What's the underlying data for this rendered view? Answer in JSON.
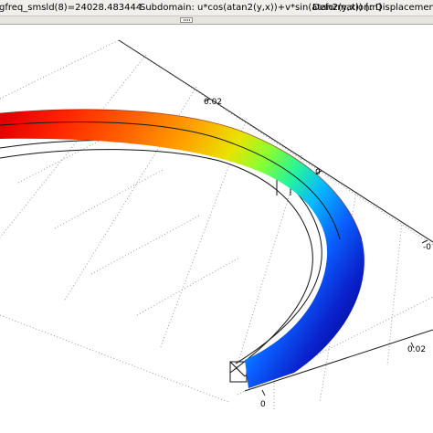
{
  "status_bar": {
    "eigenfreq_text": "gfreq_smsld(8)=24028.483444",
    "subdomain_text": "Subdomain: u*cos(atan2(y,x))+v*sin(atan2(y,x)) [m]",
    "deformation_text": "Deformation: Displacement"
  },
  "axes": {
    "tick_y_top": "0.02",
    "tick_y_mid": "0",
    "tick_right_partial": "-0",
    "tick_x_right": "0.02",
    "tick_x_bottom": "0"
  },
  "colormap": [
    "#e00000",
    "#ff4a00",
    "#ff9a00",
    "#e6e600",
    "#7fff3a",
    "#21f0a6",
    "#0ab8ff",
    "#0a60ff",
    "#0a1ec8",
    "#00058f"
  ],
  "icons": {
    "splitter": "splitter-grip-icon"
  }
}
